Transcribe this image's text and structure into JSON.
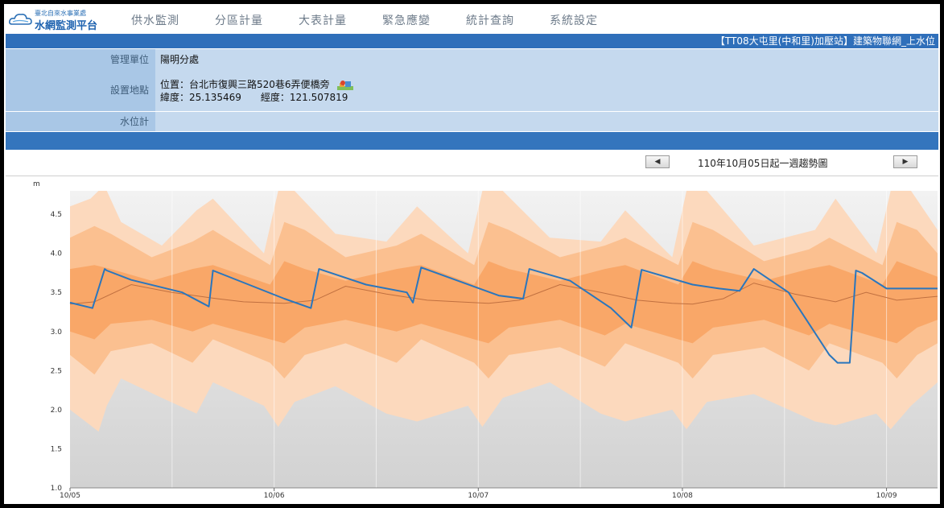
{
  "app": {
    "org": "臺北自來水事業處",
    "name": "水網監測平台"
  },
  "nav": [
    {
      "label": "供水監測"
    },
    {
      "label": "分區計量"
    },
    {
      "label": "大表計量"
    },
    {
      "label": "緊急應變"
    },
    {
      "label": "統計查詢"
    },
    {
      "label": "系統設定"
    }
  ],
  "station_title": "【TT08大屯里(中和里)加壓站】建築物聯網_上水位",
  "info": {
    "unit_label": "管理單位",
    "unit_value": "陽明分處",
    "location_label": "設置地點",
    "address": "位置：台北市復興三路520巷6弄便橋旁",
    "coords": "緯度：25.135469　　經度：121.507819",
    "meter_label": "水位計",
    "meter_value": ""
  },
  "range_text": "110年10月05日起一週趨勢圖",
  "prev_label": "◀",
  "next_label": "▶",
  "icons": {
    "map": "map-marker-icon",
    "prev": "triangle-left-icon",
    "next": "triangle-right-icon"
  },
  "colors": {
    "accent": "#2f6fba",
    "band_outer": "#fcd9bd",
    "band_mid": "#fbc090",
    "band_inner": "#f9a768",
    "actual_line": "#2a76bd",
    "median_line": "#c07040"
  },
  "chart_data": {
    "type": "line",
    "ylabel": "m",
    "ylim": [
      1.0,
      4.8
    ],
    "yticks": [
      1.0,
      1.5,
      2.0,
      2.5,
      3.0,
      3.5,
      4.0,
      4.5
    ],
    "xlim": [
      0,
      4.25
    ],
    "xticks": [
      {
        "x": 0,
        "label": "10/05"
      },
      {
        "x": 1,
        "label": "10/06"
      },
      {
        "x": 2,
        "label": "10/07"
      },
      {
        "x": 3,
        "label": "10/08"
      },
      {
        "x": 4,
        "label": "10/09"
      }
    ],
    "grid": true,
    "series": [
      {
        "role": "actual",
        "x": [
          0,
          0.11,
          0.17,
          0.18,
          0.3,
          0.55,
          0.68,
          0.7,
          1.05,
          1.18,
          1.22,
          1.45,
          1.65,
          1.68,
          1.72,
          2.1,
          2.22,
          2.25,
          2.45,
          2.65,
          2.75,
          2.8,
          3.05,
          3.18,
          3.28,
          3.35,
          3.52,
          3.72,
          3.76,
          3.82,
          3.85,
          3.88,
          4.0,
          4.25
        ],
        "y": [
          3.37,
          3.3,
          3.8,
          3.78,
          3.66,
          3.5,
          3.32,
          3.78,
          3.42,
          3.3,
          3.8,
          3.6,
          3.5,
          3.37,
          3.82,
          3.46,
          3.42,
          3.8,
          3.65,
          3.3,
          3.05,
          3.79,
          3.6,
          3.55,
          3.52,
          3.8,
          3.5,
          2.7,
          2.6,
          2.6,
          3.78,
          3.75,
          3.55,
          3.55
        ]
      },
      {
        "role": "median",
        "x": [
          0,
          0.12,
          0.3,
          0.5,
          0.72,
          0.85,
          1.05,
          1.2,
          1.35,
          1.55,
          1.75,
          1.9,
          2.05,
          2.2,
          2.4,
          2.6,
          2.78,
          2.95,
          3.05,
          3.2,
          3.35,
          3.55,
          3.75,
          3.9,
          4.05,
          4.25
        ],
        "y": [
          3.35,
          3.38,
          3.6,
          3.5,
          3.42,
          3.38,
          3.36,
          3.4,
          3.58,
          3.48,
          3.4,
          3.38,
          3.36,
          3.4,
          3.6,
          3.5,
          3.4,
          3.36,
          3.35,
          3.42,
          3.62,
          3.48,
          3.38,
          3.5,
          3.4,
          3.45
        ]
      }
    ],
    "bands": [
      {
        "role": "outer",
        "x": [
          0,
          0.1,
          0.14,
          0.18,
          0.25,
          0.45,
          0.62,
          0.7,
          0.95,
          1.02,
          1.1,
          1.3,
          1.55,
          1.7,
          1.95,
          2.02,
          2.12,
          2.35,
          2.6,
          2.72,
          2.95,
          3.02,
          3.12,
          3.35,
          3.65,
          3.75,
          3.95,
          4.02,
          4.12,
          4.25
        ],
        "upper": [
          4.6,
          4.7,
          4.8,
          4.8,
          4.4,
          4.1,
          4.55,
          4.7,
          4.0,
          4.8,
          4.8,
          4.25,
          4.15,
          4.6,
          4.0,
          4.8,
          4.8,
          4.2,
          4.15,
          4.55,
          3.95,
          4.8,
          4.8,
          4.1,
          4.3,
          4.7,
          4.0,
          4.8,
          4.8,
          4.3
        ],
        "lower": [
          2.0,
          1.8,
          1.72,
          2.05,
          2.4,
          2.15,
          1.95,
          2.35,
          2.05,
          1.78,
          2.1,
          2.3,
          1.95,
          1.85,
          2.05,
          1.78,
          2.15,
          2.35,
          1.95,
          1.85,
          2.0,
          1.75,
          2.1,
          2.2,
          1.85,
          1.8,
          1.95,
          1.75,
          2.05,
          2.35
        ]
      },
      {
        "role": "mid",
        "x": [
          0,
          0.12,
          0.2,
          0.4,
          0.6,
          0.7,
          0.98,
          1.05,
          1.15,
          1.35,
          1.6,
          1.72,
          1.98,
          2.05,
          2.15,
          2.4,
          2.62,
          2.72,
          2.98,
          3.05,
          3.15,
          3.4,
          3.62,
          3.72,
          3.98,
          4.05,
          4.15,
          4.25
        ],
        "upper": [
          4.2,
          4.35,
          4.25,
          3.95,
          4.15,
          4.3,
          3.85,
          4.4,
          4.3,
          3.95,
          4.1,
          4.25,
          3.85,
          4.4,
          4.3,
          3.95,
          4.1,
          4.2,
          3.85,
          4.4,
          4.3,
          3.9,
          4.05,
          4.2,
          3.85,
          4.4,
          4.3,
          4.0
        ],
        "lower": [
          2.7,
          2.45,
          2.75,
          2.85,
          2.6,
          2.9,
          2.6,
          2.4,
          2.7,
          2.85,
          2.6,
          2.9,
          2.6,
          2.4,
          2.7,
          2.8,
          2.55,
          2.85,
          2.6,
          2.4,
          2.7,
          2.8,
          2.5,
          2.85,
          2.6,
          2.4,
          2.7,
          2.85
        ]
      },
      {
        "role": "inner",
        "x": [
          0,
          0.12,
          0.2,
          0.4,
          0.6,
          0.7,
          0.98,
          1.05,
          1.15,
          1.35,
          1.6,
          1.72,
          1.98,
          2.05,
          2.15,
          2.4,
          2.62,
          2.72,
          2.98,
          3.05,
          3.15,
          3.4,
          3.62,
          3.72,
          3.98,
          4.05,
          4.15,
          4.25
        ],
        "upper": [
          3.8,
          3.85,
          3.8,
          3.65,
          3.8,
          3.85,
          3.6,
          3.9,
          3.8,
          3.65,
          3.8,
          3.85,
          3.6,
          3.9,
          3.8,
          3.65,
          3.8,
          3.85,
          3.6,
          3.9,
          3.8,
          3.65,
          3.8,
          3.85,
          3.6,
          3.9,
          3.8,
          3.7
        ],
        "lower": [
          3.0,
          2.9,
          3.1,
          3.15,
          3.0,
          3.1,
          2.9,
          2.85,
          3.05,
          3.15,
          3.0,
          3.1,
          2.9,
          2.85,
          3.05,
          3.15,
          2.95,
          3.1,
          2.9,
          2.85,
          3.05,
          3.15,
          2.95,
          3.1,
          2.9,
          2.85,
          3.05,
          3.15
        ]
      }
    ]
  }
}
